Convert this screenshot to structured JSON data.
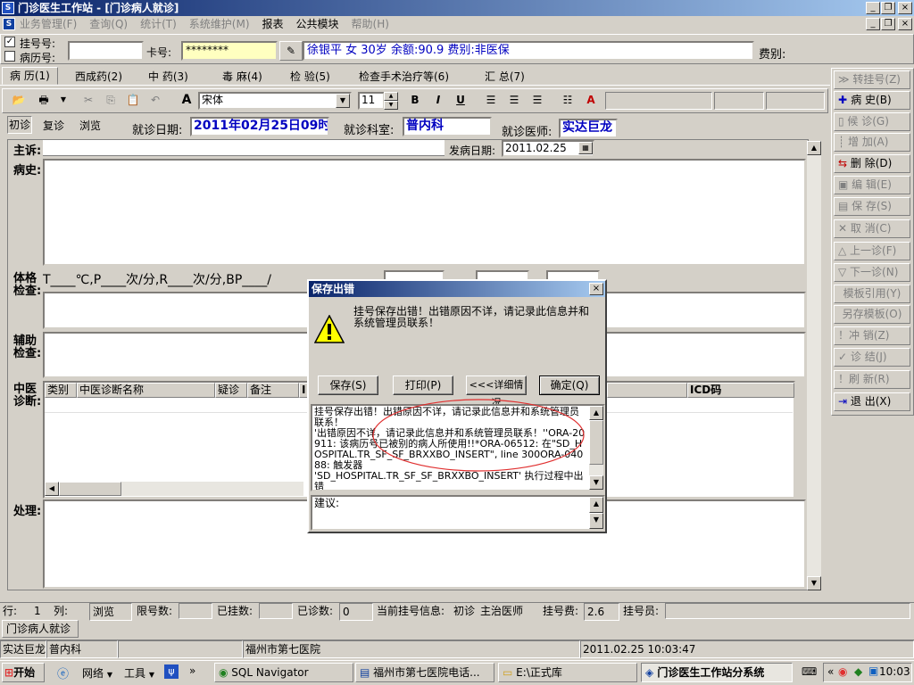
{
  "window": {
    "title": "门诊医生工作站 - [门诊病人就诊]",
    "app_icon": "S"
  },
  "menu": [
    "业务管理(F)",
    "查询(Q)",
    "统计(T)",
    "系统维护(M)",
    "报表",
    "公共模块",
    "帮助(H)"
  ],
  "patient_bar": {
    "reg_no_label": "挂号号:",
    "record_no_label": "病历号:",
    "card_label": "卡号:",
    "card_value": "********",
    "patient_info": "徐银平 女 30岁 余额:90.9 费别:非医保",
    "fee_label": "费别:"
  },
  "tabs": [
    "病 历(1)",
    "西成药(2)",
    "中 药(3)",
    "毒 麻(4)",
    "检 验(5)",
    "检查手术治疗等(6)",
    "汇 总(7)"
  ],
  "toolbar": {
    "font_name": "宋体",
    "font_size": "11",
    "bold": "B",
    "italic": "I",
    "underline": "U"
  },
  "visit": {
    "tabs": [
      "初诊",
      "复诊",
      "浏览"
    ],
    "date_label": "就诊日期:",
    "date_value": "2011年02月25日09时",
    "dept_label": "就诊科室:",
    "dept_value": "普内科",
    "doctor_label": "就诊医师:",
    "doctor_value": "实达巨龙"
  },
  "form": {
    "complaint_label": "主诉:",
    "onset_label": "发病日期:",
    "onset_value": "2011.02.25",
    "history_label": "病史:",
    "exam_label1": "体格",
    "exam_label2": "检查:",
    "vitals": "T____℃,P____次/分,R____次/分,BP____/",
    "aux_label1": "辅助",
    "aux_label2": "检查:",
    "tcm_label1": "中医",
    "tcm_label2": "诊断:",
    "treat_label": "处理:",
    "diag_cols": [
      "类别",
      "中医诊断名称",
      "疑诊",
      "备注",
      "I"
    ],
    "icd_col": "ICD码"
  },
  "sidebar": [
    {
      "label": "转挂号(Z)",
      "icon": "double-arrow-icon",
      "enabled": false
    },
    {
      "label": "病 史(B)",
      "icon": "plus-icon",
      "enabled": true
    },
    {
      "label": "候 诊(G)",
      "icon": "page-icon",
      "enabled": false
    },
    {
      "label": "增 加(A)",
      "icon": "add-icon",
      "enabled": false
    },
    {
      "label": "删 除(D)",
      "icon": "delete-icon",
      "enabled": true
    },
    {
      "label": "编 辑(E)",
      "icon": "edit-icon",
      "enabled": false
    },
    {
      "label": "保 存(S)",
      "icon": "save-icon",
      "enabled": false
    },
    {
      "label": "取 消(C)",
      "icon": "cancel-icon",
      "enabled": false
    },
    {
      "label": "上一诊(F)",
      "icon": "up-icon",
      "enabled": false
    },
    {
      "label": "下一诊(N)",
      "icon": "down-icon",
      "enabled": false
    },
    {
      "label": "模板引用(Y)",
      "icon": "",
      "enabled": false
    },
    {
      "label": "另存模板(O)",
      "icon": "",
      "enabled": false
    },
    {
      "label": "冲 销(Z)",
      "icon": "exclaim-icon",
      "enabled": false
    },
    {
      "label": "诊 结(J)",
      "icon": "check-icon",
      "enabled": false
    },
    {
      "label": "刷 新(R)",
      "icon": "exclaim-icon",
      "enabled": false
    },
    {
      "label": "退 出(X)",
      "icon": "exit-icon",
      "enabled": true
    }
  ],
  "dialog": {
    "title": "保存出错",
    "message": "挂号保存出错！出错原因不详，请记录此信息并和系统管理员联系！",
    "buttons": [
      "保存(S)",
      "打印(P)",
      "<<<详细情况",
      "确定(Q)"
    ],
    "detail": "挂号保存出错！出错原因不详，请记录此信息并和系统管理员联系！\n'出错原因不详，请记录此信息并和系统管理员联系！''ORA-20911: 该病历号已被别的病人所使用!!*ORA-06512: 在\"SD_HOSPITAL.TR_SF_SF_BRXXBO_INSERT\", line 300ORA-04088: 触发器\n'SD_HOSPITAL.TR_SF_SF_BRXXBO_INSERT' 执行过程中出错",
    "suggest_label": "建议:"
  },
  "status": {
    "row_label": "行:",
    "row_value": "1",
    "col_label": "列:",
    "mode": "浏览",
    "count_label": "限号数:",
    "registered_label": "已挂数:",
    "visited_label": "已诊数:",
    "visited_value": "0",
    "current_label": "当前挂号信息:",
    "visit_type": "初诊",
    "doctor_type": "主治医师",
    "fee_label": "挂号费:",
    "fee_value": "2.6",
    "clerk_label": "挂号员:"
  },
  "mdi_tab": "门诊病人就诊",
  "footer": {
    "user": "实达巨龙",
    "dept": "普内科",
    "hospital": "福州市第七医院",
    "datetime": "2011.02.25 10:03:47"
  },
  "taskbar": {
    "start": "开始",
    "network": "网络",
    "tools": "工具",
    "tasks": [
      "SQL Navigator",
      "福州市第七医院电话...",
      "E:\\正式库",
      "门诊医生工作站分系统"
    ],
    "clock": "10:03"
  }
}
